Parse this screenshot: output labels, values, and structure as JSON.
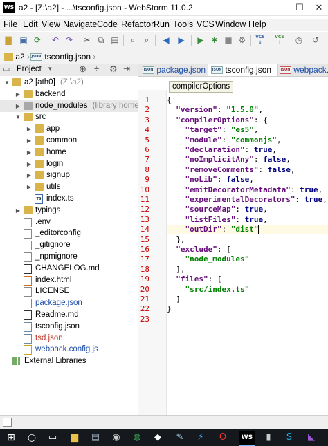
{
  "window": {
    "app_icon": "WS",
    "title": "a2 - [Z:\\a2] - ...\\tsconfig.json - WebStorm 11.0.2",
    "controls": {
      "minimize": "—",
      "maximize": "☐",
      "close": "✕"
    }
  },
  "menu": [
    "File",
    "Edit",
    "View",
    "Navigate",
    "Code",
    "Refactor",
    "Run",
    "Tools",
    "VCS",
    "Window",
    "Help"
  ],
  "toolbar": {
    "vcs1": "VCS",
    "vcs2": "VCS"
  },
  "breadcrumb": {
    "project": "a2",
    "file": "tsconfig.json"
  },
  "project_panel": {
    "title": "Project",
    "json_icon": "JSON",
    "ts_icon": "TS",
    "tree": [
      {
        "label": "a2 [ath0]",
        "hint": "(Z:\\a2)",
        "type": "folder",
        "depth": 0,
        "expanded": true
      },
      {
        "label": "backend",
        "type": "folder",
        "depth": 1,
        "expanded": false
      },
      {
        "label": "node_modules",
        "hint": "(library home)",
        "type": "folder-gray",
        "depth": 1,
        "expanded": false,
        "selected": true
      },
      {
        "label": "src",
        "type": "folder",
        "depth": 1,
        "expanded": true
      },
      {
        "label": "app",
        "type": "folder",
        "depth": 2,
        "expanded": false
      },
      {
        "label": "common",
        "type": "folder",
        "depth": 2,
        "expanded": false
      },
      {
        "label": "home",
        "type": "folder",
        "depth": 2,
        "expanded": false
      },
      {
        "label": "login",
        "type": "folder",
        "depth": 2,
        "expanded": false
      },
      {
        "label": "signup",
        "type": "folder",
        "depth": 2,
        "expanded": false
      },
      {
        "label": "utils",
        "type": "folder",
        "depth": 2,
        "expanded": false
      },
      {
        "label": "index.ts",
        "type": "ts",
        "depth": 2
      },
      {
        "label": "typings",
        "type": "folder",
        "depth": 1,
        "expanded": false
      },
      {
        "label": ".env",
        "type": "file",
        "depth": 1
      },
      {
        "label": "_editorconfig",
        "type": "file",
        "depth": 1
      },
      {
        "label": "_gitignore",
        "type": "file",
        "depth": 1
      },
      {
        "label": "_npmignore",
        "type": "file",
        "depth": 1
      },
      {
        "label": "CHANGELOG.md",
        "type": "md",
        "depth": 1
      },
      {
        "label": "index.html",
        "type": "html",
        "depth": 1
      },
      {
        "label": "LICENSE",
        "type": "file",
        "depth": 1
      },
      {
        "label": "package.json",
        "type": "json",
        "depth": 1,
        "color": "#1f4fa8"
      },
      {
        "label": "Readme.md",
        "type": "md",
        "depth": 1
      },
      {
        "label": "tsconfig.json",
        "type": "json",
        "depth": 1
      },
      {
        "label": "tsd.json",
        "type": "json",
        "depth": 1,
        "color": "#c0392b"
      },
      {
        "label": "webpack.config.js",
        "type": "js",
        "depth": 1,
        "color": "#1f4fa8"
      },
      {
        "label": "External Libraries",
        "type": "lib",
        "depth": 0
      }
    ]
  },
  "editor": {
    "tabs": [
      {
        "label": "package.json",
        "icon": "JSON",
        "active": false,
        "color": "#1f4fa8"
      },
      {
        "label": "tsconfig.json",
        "icon": "JSON",
        "active": true,
        "color": "#000000"
      },
      {
        "label": "webpack.con",
        "icon": "JSON",
        "active": false,
        "color": "#1f4fa8"
      }
    ],
    "tooltip": "compilerOptions",
    "current_line": 14,
    "lines": [
      "{",
      "  \"version\": \"1.5.0\",",
      "  \"compilerOptions\": {",
      "    \"target\": \"es5\",",
      "    \"module\": \"commonjs\",",
      "    \"declaration\": true,",
      "    \"noImplicitAny\": false,",
      "    \"removeComments\": false,",
      "    \"noLib\": false,",
      "    \"emitDecoratorMetadata\": true,",
      "    \"experimentalDecorators\": true,",
      "    \"sourceMap\": true,",
      "    \"listFiles\": true,",
      "    \"outDir\": \"dist\"",
      "  },",
      "  \"exclude\": [",
      "    \"node_modules\"",
      "  ],",
      "  \"files\": [",
      "    \"src/index.ts\"",
      "  ]",
      "}",
      ""
    ]
  },
  "taskbar": {
    "ws_label": "WS"
  }
}
